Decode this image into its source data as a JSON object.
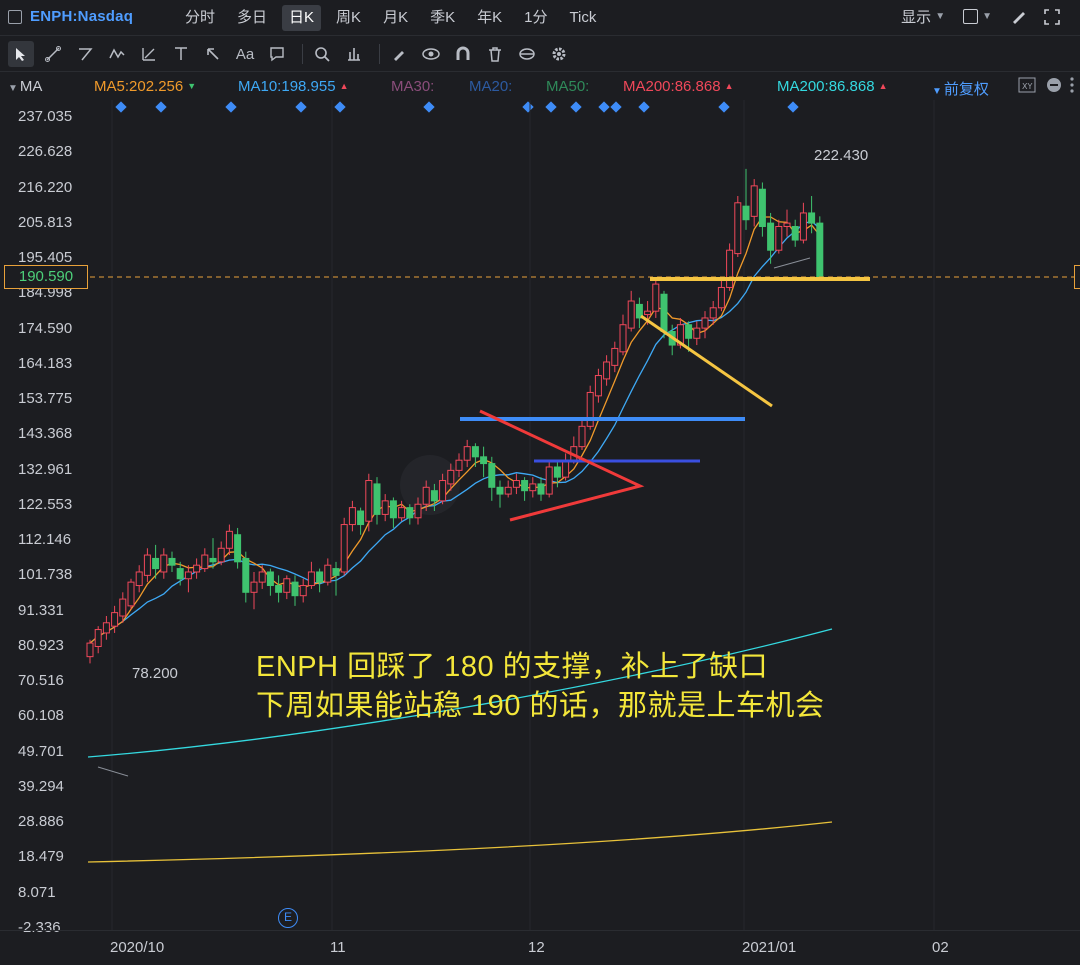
{
  "header": {
    "symbol": "ENPH:Nasdaq",
    "tabs": [
      "分时",
      "多日",
      "日K",
      "周K",
      "月K",
      "季K",
      "年K",
      "1分",
      "Tick"
    ],
    "active_tab": "日K",
    "display_label": "显示"
  },
  "toolbar": {
    "tool_icons": [
      "cursor-icon",
      "line-tool-icon",
      "polyline-tool-icon",
      "wave-tool-icon",
      "fib-tool-icon",
      "level-tool-icon",
      "arrow-tool-icon",
      "text-tool-icon",
      "note-tool-icon",
      "magnifier-icon",
      "measure-icon",
      "pen-icon",
      "eye-icon",
      "magnet-icon",
      "trash-icon",
      "sync-icon",
      "gear-icon"
    ],
    "text_tool_label": "Aa"
  },
  "ma_legend": {
    "label": "MA",
    "items": [
      {
        "text": "MA5:202.256",
        "color": "#f09a2b",
        "trend": "▼",
        "trend_color": "#3fc36f"
      },
      {
        "text": "MA10:198.955",
        "color": "#3ea9f5",
        "trend": "▲",
        "trend_color": "#f0485a"
      },
      {
        "text": "MA30:",
        "color": "#8a4d7a",
        "trend": "",
        "trend_color": ""
      },
      {
        "text": "MA20:",
        "color": "#2c5aa0",
        "trend": "",
        "trend_color": ""
      },
      {
        "text": "MA50:",
        "color": "#2f8a5a",
        "trend": "",
        "trend_color": ""
      },
      {
        "text": "MA200:86.868",
        "color": "#f0485a",
        "trend": "▲",
        "trend_color": "#f0485a"
      },
      {
        "text": "MA200:86.868",
        "color": "#34d9e0",
        "trend": "▲",
        "trend_color": "#f0485a"
      }
    ],
    "adjust_label": "前复权"
  },
  "price_axis": {
    "labels": [
      "237.035",
      "226.628",
      "216.220",
      "205.813",
      "195.405",
      "184.998",
      "174.590",
      "164.183",
      "153.775",
      "143.368",
      "132.961",
      "122.553",
      "112.146",
      "101.738",
      "91.331",
      "80.923",
      "70.516",
      "60.108",
      "49.701",
      "39.294",
      "28.886",
      "18.479",
      "8.071",
      "-2.336"
    ],
    "current_price": "190.590"
  },
  "time_axis": {
    "labels": [
      "2020/10",
      "11",
      "12",
      "2021/01",
      "02"
    ]
  },
  "chart": {
    "high_callout": "222.430",
    "low_callout": "78.200",
    "earnings_badge": "E"
  },
  "annotation": {
    "line1": "ENPH 回踩了 180 的支撑，补上了缺口",
    "line2": "下周如果能站稳 190 的话，那就是上车机会"
  },
  "colors": {
    "up": "#f0485a",
    "down": "#3fc36f",
    "ma5": "#f09a2b",
    "ma10": "#3ea9f5",
    "annotation": "#f3e63a"
  },
  "chart_data": {
    "type": "candlestick",
    "title": "ENPH:Nasdaq",
    "ylim": [
      -2.336,
      237.035
    ],
    "candles": [
      [
        78,
        82,
        76,
        83
      ],
      [
        81,
        86,
        79,
        87
      ],
      [
        85,
        88,
        83,
        90
      ],
      [
        87,
        91,
        85,
        93
      ],
      [
        90,
        95,
        88,
        97
      ],
      [
        93,
        100,
        92,
        101
      ],
      [
        99,
        103,
        97,
        105
      ],
      [
        102,
        108,
        100,
        110
      ],
      [
        107,
        104,
        101,
        111
      ],
      [
        103,
        108,
        101,
        110
      ],
      [
        107,
        105,
        103,
        109
      ],
      [
        104,
        101,
        99,
        106
      ],
      [
        101,
        103,
        97,
        105
      ],
      [
        103,
        105,
        101,
        107
      ],
      [
        104,
        108,
        103,
        110
      ],
      [
        107,
        106,
        104,
        113
      ],
      [
        106,
        110,
        105,
        112
      ],
      [
        110,
        115,
        108,
        117
      ],
      [
        114,
        106,
        104,
        116
      ],
      [
        107,
        97,
        94,
        109
      ],
      [
        97,
        100,
        92,
        103
      ],
      [
        100,
        103,
        98,
        105
      ],
      [
        103,
        99,
        96,
        104
      ],
      [
        99,
        97,
        94,
        102
      ],
      [
        97,
        101,
        95,
        102
      ],
      [
        100,
        96,
        93,
        102
      ],
      [
        96,
        99,
        94,
        101
      ],
      [
        99,
        103,
        98,
        106
      ],
      [
        103,
        100,
        97,
        104
      ],
      [
        100,
        105,
        99,
        107
      ],
      [
        104,
        102,
        96,
        106
      ],
      [
        103,
        117,
        102,
        119
      ],
      [
        117,
        122,
        115,
        124
      ],
      [
        121,
        117,
        114,
        122
      ],
      [
        118,
        130,
        115,
        132
      ],
      [
        129,
        120,
        117,
        131
      ],
      [
        120,
        124,
        118,
        126
      ],
      [
        124,
        119,
        116,
        125
      ],
      [
        119,
        122,
        118,
        124
      ],
      [
        122,
        119,
        117,
        123
      ],
      [
        119,
        123,
        117,
        125
      ],
      [
        123,
        128,
        121,
        130
      ],
      [
        127,
        124,
        121,
        129
      ],
      [
        124,
        130,
        123,
        132
      ],
      [
        129,
        133,
        127,
        135
      ],
      [
        133,
        136,
        131,
        138
      ],
      [
        136,
        140,
        134,
        142
      ],
      [
        140,
        137,
        134,
        141
      ],
      [
        137,
        135,
        131,
        140
      ],
      [
        135,
        128,
        124,
        137
      ],
      [
        128,
        126,
        122,
        130
      ],
      [
        126,
        128,
        125,
        130
      ],
      [
        128,
        130,
        126,
        132
      ],
      [
        130,
        127,
        124,
        131
      ],
      [
        127,
        129,
        125,
        131
      ],
      [
        129,
        126,
        124,
        131
      ],
      [
        126,
        134,
        125,
        136
      ],
      [
        134,
        131,
        128,
        136
      ],
      [
        131,
        136,
        130,
        138
      ],
      [
        136,
        140,
        135,
        143
      ],
      [
        140,
        146,
        139,
        148
      ],
      [
        146,
        156,
        145,
        158
      ],
      [
        155,
        161,
        153,
        163
      ],
      [
        160,
        165,
        158,
        167
      ],
      [
        164,
        169,
        162,
        171
      ],
      [
        168,
        176,
        167,
        179
      ],
      [
        175,
        183,
        174,
        186
      ],
      [
        182,
        178,
        175,
        184
      ],
      [
        179,
        180,
        176,
        183
      ],
      [
        180,
        188,
        178,
        189
      ],
      [
        185,
        174,
        172,
        186
      ],
      [
        174,
        170,
        167,
        176
      ],
      [
        170,
        176,
        169,
        178
      ],
      [
        176,
        172,
        168,
        177
      ],
      [
        172,
        175,
        170,
        177
      ],
      [
        175,
        178,
        172,
        180
      ],
      [
        178,
        181,
        176,
        183
      ],
      [
        181,
        187,
        180,
        189
      ],
      [
        187,
        198,
        186,
        200
      ],
      [
        197,
        212,
        196,
        214
      ],
      [
        211,
        207,
        204,
        222
      ],
      [
        208,
        217,
        205,
        219
      ],
      [
        216,
        205,
        202,
        218
      ],
      [
        206,
        198,
        194,
        209
      ],
      [
        198,
        205,
        197,
        207
      ],
      [
        205,
        206,
        202,
        210
      ],
      [
        205,
        201,
        199,
        207
      ],
      [
        201,
        209,
        200,
        212
      ],
      [
        209,
        206,
        203,
        214
      ],
      [
        206,
        190,
        189,
        208
      ]
    ],
    "series": [
      {
        "name": "MA5",
        "values": [
          202.256
        ]
      },
      {
        "name": "MA10",
        "values": [
          198.955
        ]
      },
      {
        "name": "MA200",
        "values": [
          86.868
        ]
      }
    ]
  }
}
